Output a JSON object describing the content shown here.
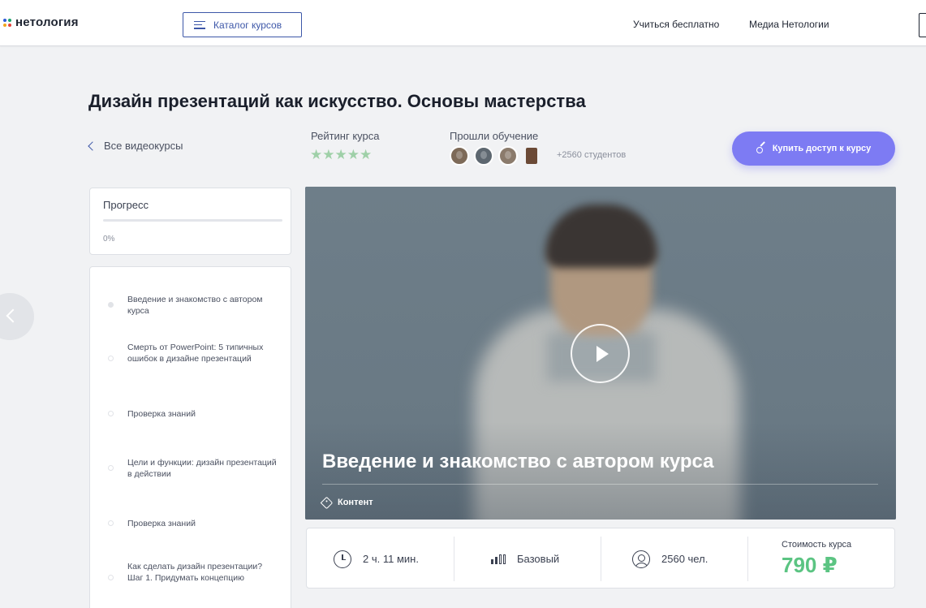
{
  "header": {
    "logo_text": "нетология",
    "catalog_label": "Каталог курсов",
    "nav": [
      "Учиться бесплатно",
      "Медиа Нетологии"
    ]
  },
  "course": {
    "title": "Дизайн презентаций как искусство. Основы мастерства",
    "back_label": "Все видеокурсы",
    "rating_label": "Рейтинг курса",
    "rating_stars": "★★★★★",
    "rating_value": 5,
    "alumni_label": "Прошли обучение",
    "students_label": "+2560 студентов",
    "buy_label": "Купить доступ к курсу"
  },
  "progress": {
    "title": "Прогресс",
    "value_label": "0%",
    "fraction": 0
  },
  "lessons": [
    {
      "label": "Введение и знакомство с автором курса",
      "active": true
    },
    {
      "label": "Смерть от PowerPoint: 5 типичных ошибок в дизайне презентаций",
      "active": false
    },
    {
      "label": "Проверка знаний",
      "active": false
    },
    {
      "label": "Цели и функции: дизайн презентаций в действии",
      "active": false
    },
    {
      "label": "Проверка знаний",
      "active": false
    },
    {
      "label": "Как сделать дизайн презентации? Шаг 1. Придумать концепцию",
      "active": false
    }
  ],
  "video": {
    "title": "Введение и знакомство с автором курса",
    "tag_label": "Контент"
  },
  "info": {
    "duration": "2 ч. 11 мин.",
    "level": "Базовый",
    "participants": "2560 чел.",
    "price_label": "Стоимость курса",
    "price_value": "790 ₽"
  },
  "colors": {
    "accent": "#3d57a8",
    "buy_button": "#7d7bf3",
    "price": "#5bc482",
    "stars": "#9fd0a8"
  },
  "icons": [
    "menu-icon",
    "chevron-left-icon",
    "key-icon",
    "play-icon",
    "tag-icon",
    "clock-icon",
    "level-icon",
    "user-icon"
  ]
}
